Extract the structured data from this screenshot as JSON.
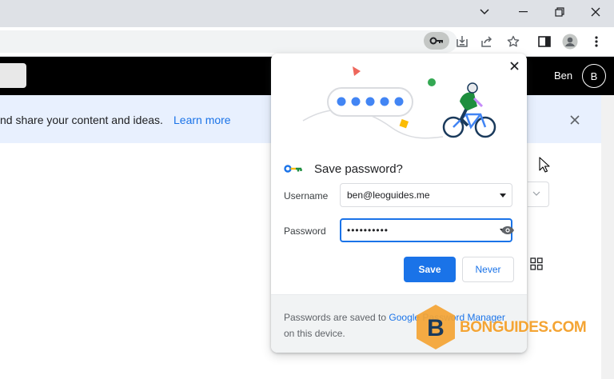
{
  "window": {
    "minimize_icon": "chevron-down-icon",
    "controls": [
      "minimize-icon",
      "restore-icon",
      "close-icon"
    ]
  },
  "toolbar": {
    "icons": [
      "key-icon",
      "install-app-icon",
      "share-icon",
      "bookmark-star-icon",
      "side-panel-icon",
      "profile-icon",
      "more-menu-icon"
    ]
  },
  "page_header": {
    "user_name": "Ben",
    "avatar_letter": "B"
  },
  "infobar": {
    "text": "nd share your content and ideas.",
    "link": "Learn more"
  },
  "popup": {
    "title": "Save password?",
    "username_label": "Username",
    "username_value": "ben@leoguides.me",
    "password_label": "Password",
    "password_value": "••••••••••",
    "save_label": "Save",
    "never_label": "Never",
    "footer_prefix": "Passwords are saved to ",
    "footer_link": "Google Password Manager",
    "footer_suffix": " on this device.",
    "accent_color": "#1a73e8"
  },
  "watermark": {
    "letter": "B",
    "text": "BONGUIDES.COM",
    "color": "#f4a433"
  }
}
